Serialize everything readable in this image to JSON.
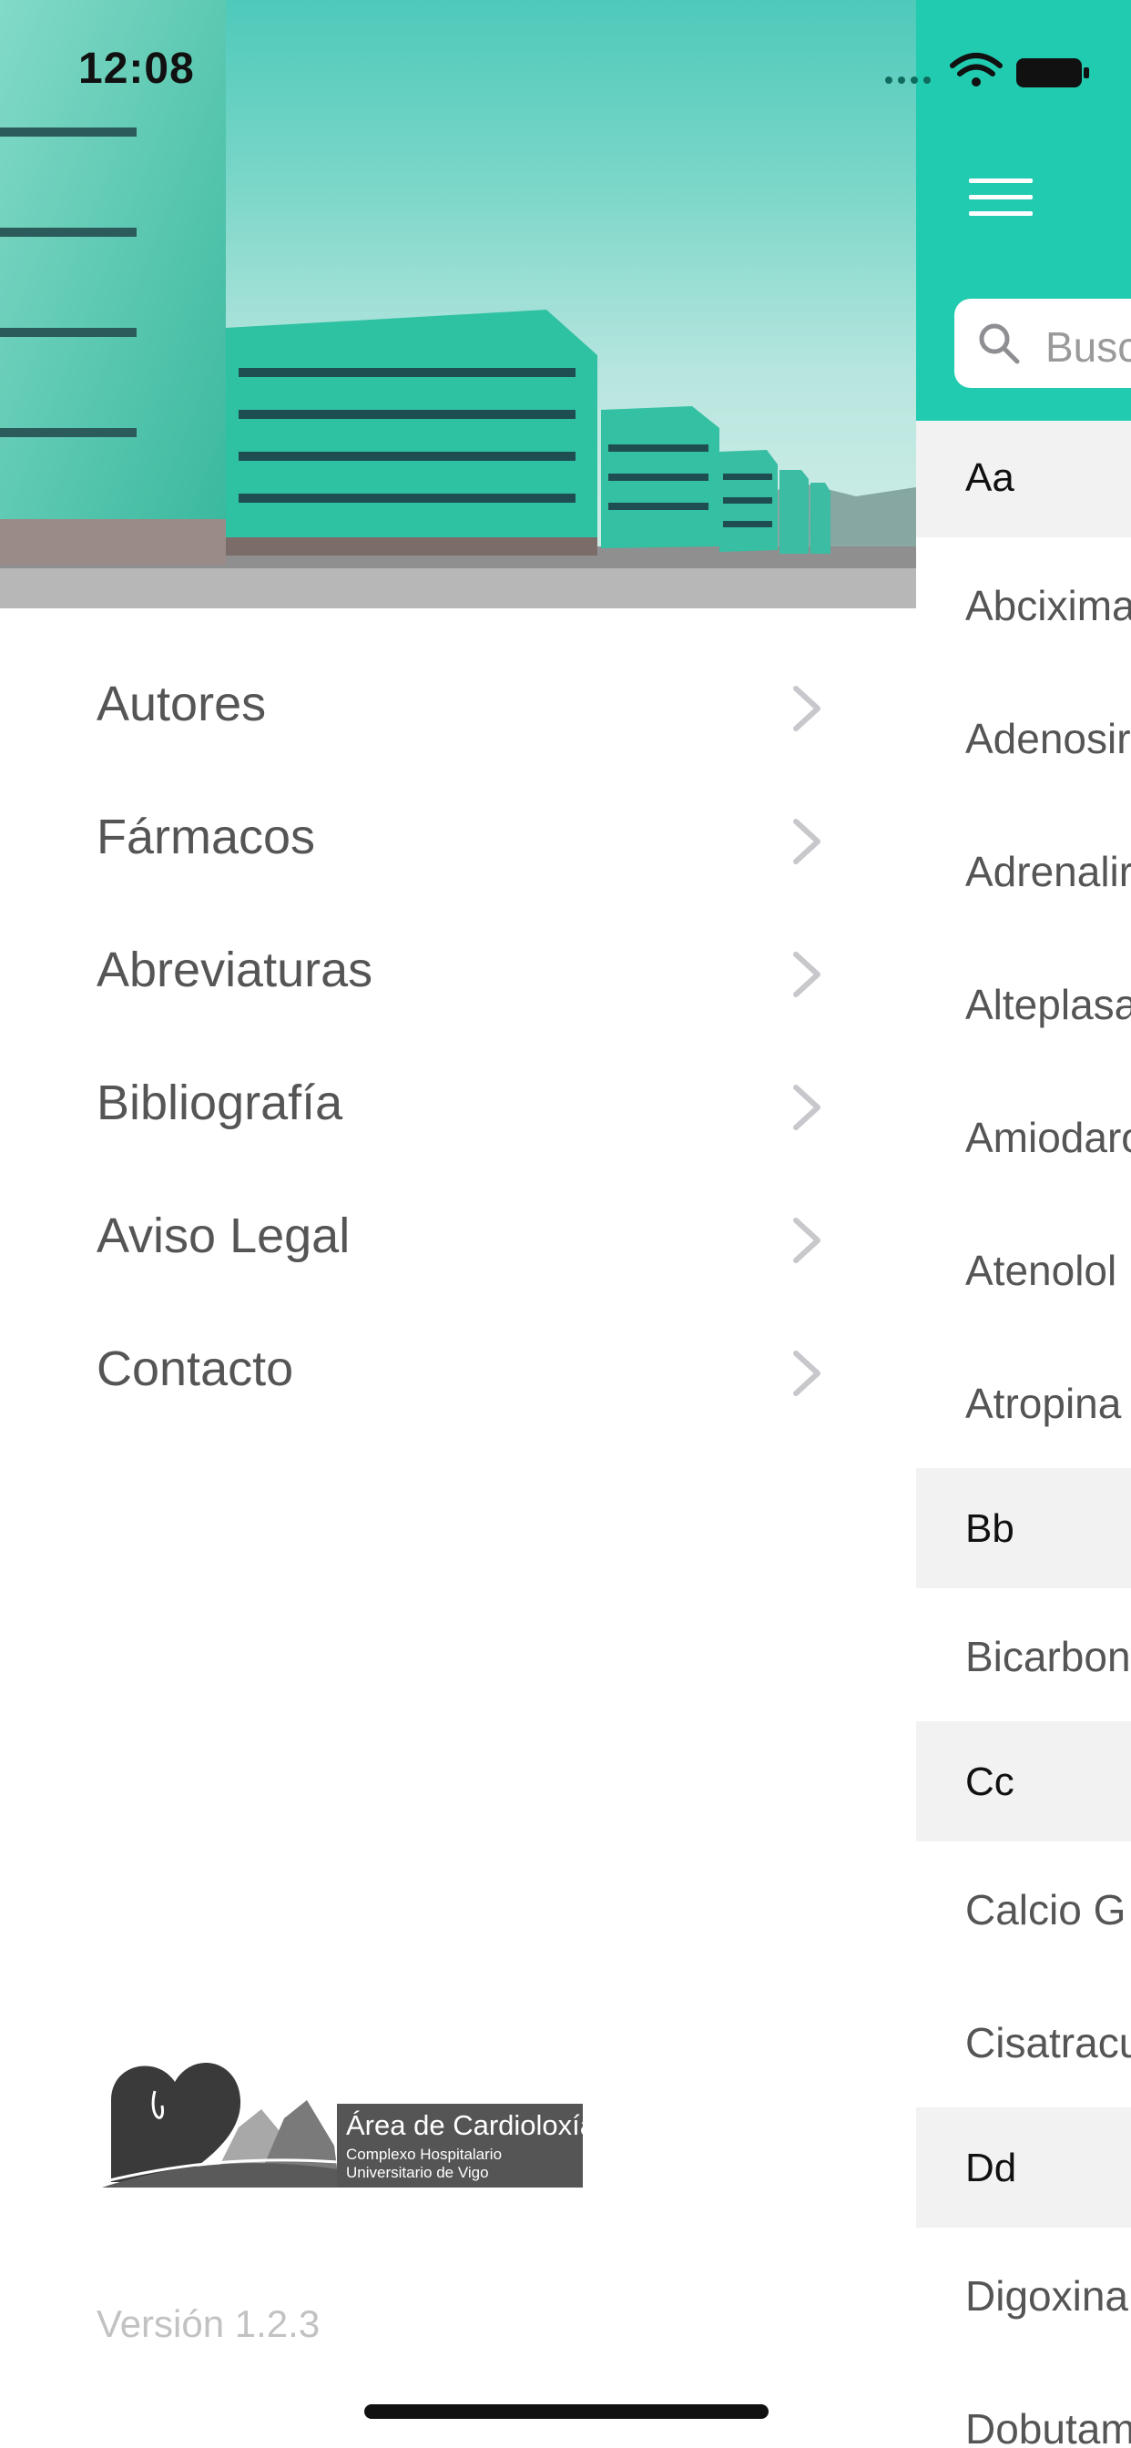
{
  "status_bar": {
    "time": "12:08"
  },
  "drawer": {
    "menu": [
      {
        "label": "Autores"
      },
      {
        "label": "Fármacos"
      },
      {
        "label": "Abreviaturas"
      },
      {
        "label": "Bibliografía"
      },
      {
        "label": "Aviso Legal"
      },
      {
        "label": "Contacto"
      }
    ],
    "logo": {
      "title": "Área de Cardioloxía",
      "line1": "Complexo Hospitalario",
      "line2": "Universitario de Vigo"
    },
    "version": "Versión 1.2.3"
  },
  "main": {
    "search": {
      "placeholder": "Busc"
    },
    "sections": [
      {
        "header": "Aa",
        "items": [
          "Abcixima",
          "Adenosir",
          "Adrenalir",
          "Alteplasa",
          "Amiodaro",
          "Atenolol",
          "Atropina"
        ]
      },
      {
        "header": "Bb",
        "items": [
          "Bicarbon"
        ]
      },
      {
        "header": "Cc",
        "items": [
          "Calcio G",
          "Cisatracu"
        ]
      },
      {
        "header": "Dd",
        "items": [
          "Digoxina",
          "Dobutam"
        ]
      }
    ]
  },
  "colors": {
    "accent": "#21cbb0",
    "menu_text": "#555555",
    "version_text": "#c2c2c2",
    "section_bg": "#f2f2f2"
  }
}
